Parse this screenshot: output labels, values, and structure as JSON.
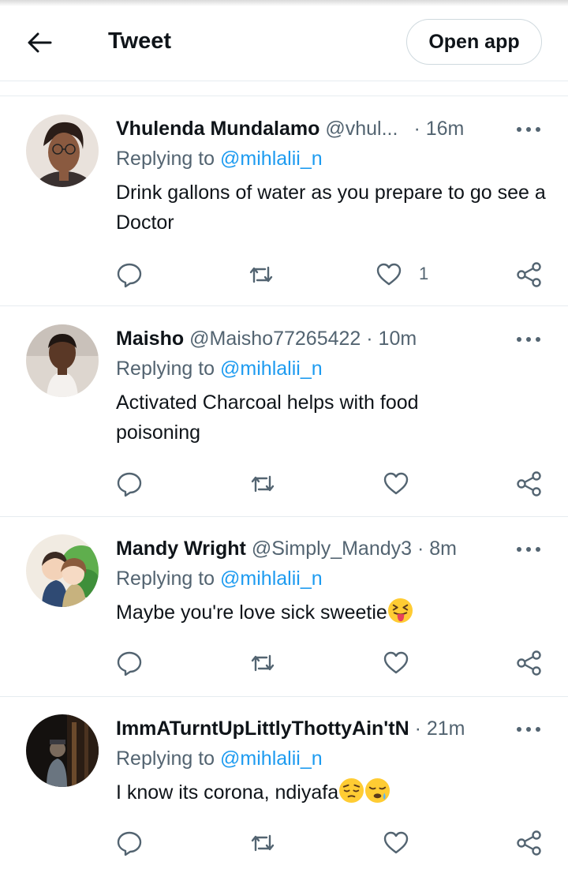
{
  "header": {
    "title": "Tweet",
    "open_app_label": "Open app"
  },
  "tweets": [
    {
      "name": "Vhulenda Mundalamo",
      "handle": "@vhul...",
      "time": "· 16m",
      "replying_prefix": "Replying to ",
      "replying_to": "@mihlalii_n",
      "text": "Drink gallons of water as you prepare to go see a Doctor",
      "like_count": "1"
    },
    {
      "name": "Maisho",
      "handle": "@Maisho77265422",
      "time": " · 10m",
      "replying_prefix": "Replying to ",
      "replying_to": "@mihlalii_n",
      "text": "Activated Charcoal helps with food poisoning",
      "like_count": ""
    },
    {
      "name": "Mandy Wright",
      "handle": "@Simply_Mandy3",
      "time": " · 8m",
      "replying_prefix": "Replying to ",
      "replying_to": "@mihlalii_n",
      "text": "Maybe you're love sick sweetie",
      "like_count": ""
    },
    {
      "name": "ImmATurntUpLittlyThottyAin'tN",
      "handle": "",
      "time": " · 21m",
      "replying_prefix": "Replying to ",
      "replying_to": "@mihlalii_n",
      "text": "I know its corona, ndiyafa",
      "like_count": ""
    }
  ],
  "icons": {
    "back": "arrow-left-icon",
    "more": "more-horizontal-icon",
    "reply": "reply-icon",
    "retweet": "retweet-icon",
    "like": "heart-icon",
    "share": "share-icon"
  },
  "colors": {
    "link": "#1d9bf0",
    "secondary": "#536471",
    "divider": "#e6ecf0"
  }
}
